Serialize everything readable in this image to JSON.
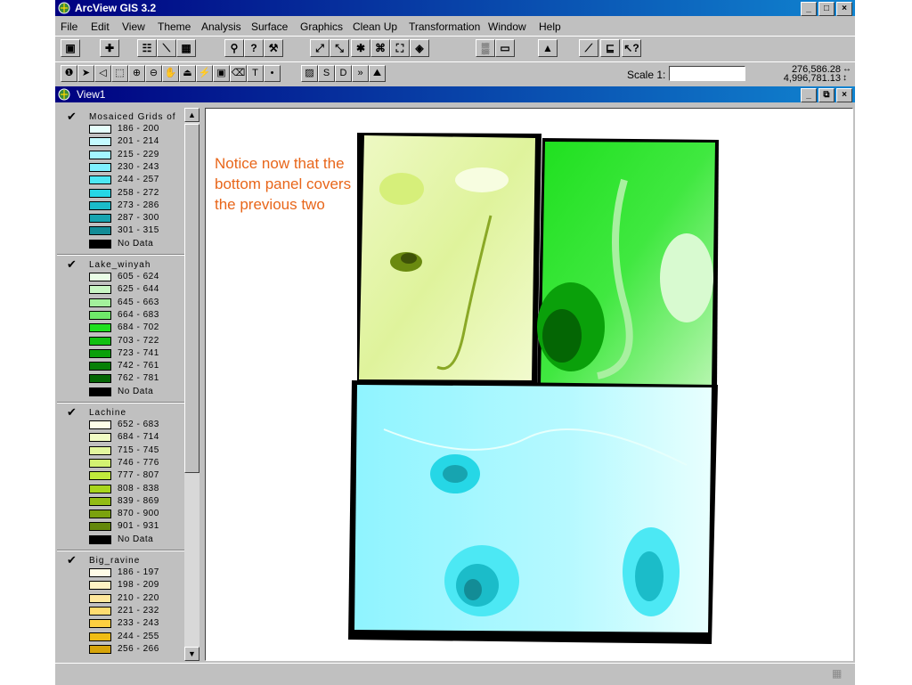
{
  "app": {
    "title": "ArcView GIS 3.2"
  },
  "window_buttons": {
    "minimize": "_",
    "maximize": "□",
    "close": "×"
  },
  "menu": [
    "File",
    "Edit",
    "View",
    "Theme",
    "Analysis",
    "Surface",
    "Graphics",
    "Clean Up",
    "Transformation",
    "Window",
    "Help"
  ],
  "toolbar": {
    "scale_label": "Scale 1:",
    "scale_value": "",
    "x_coord": "276,586.28",
    "y_coord": "4,996,781.13"
  },
  "view": {
    "title": "View1"
  },
  "note": "Notice now that the bottom panel covers the previous two",
  "themes": [
    {
      "name": "Mosaiced Grids of",
      "checked": true,
      "classes": [
        {
          "label": "186 - 200",
          "color": "#e6fffc"
        },
        {
          "label": "201 - 214",
          "color": "#c4fbff"
        },
        {
          "label": "215 - 229",
          "color": "#a3f6ff"
        },
        {
          "label": "230 - 243",
          "color": "#7ff0ff"
        },
        {
          "label": "244 - 257",
          "color": "#4ce8f4"
        },
        {
          "label": "258 - 272",
          "color": "#26d7e6"
        },
        {
          "label": "273 - 286",
          "color": "#1bbcc9"
        },
        {
          "label": "287 - 300",
          "color": "#17a4b0"
        },
        {
          "label": "301 - 315",
          "color": "#138c96"
        },
        {
          "label": "No Data",
          "color": "#000000"
        }
      ]
    },
    {
      "name": "Lake_winyah",
      "checked": true,
      "classes": [
        {
          "label": "605 - 624",
          "color": "#e9fde6"
        },
        {
          "label": "625 - 644",
          "color": "#c9f7c4"
        },
        {
          "label": "645 - 663",
          "color": "#a3f19c"
        },
        {
          "label": "664 - 683",
          "color": "#6fe86a"
        },
        {
          "label": "684 - 702",
          "color": "#1fe01f"
        },
        {
          "label": "703 - 722",
          "color": "#10c010"
        },
        {
          "label": "723 - 741",
          "color": "#0aa00a"
        },
        {
          "label": "742 - 761",
          "color": "#068006"
        },
        {
          "label": "762 - 781",
          "color": "#046604"
        },
        {
          "label": "No Data",
          "color": "#000000"
        }
      ]
    },
    {
      "name": "Lachine",
      "checked": true,
      "classes": [
        {
          "label": "652 - 683",
          "color": "#fdfde8"
        },
        {
          "label": "684 - 714",
          "color": "#f1fbc4"
        },
        {
          "label": "715 - 745",
          "color": "#e3f79e"
        },
        {
          "label": "746 - 776",
          "color": "#d3f272"
        },
        {
          "label": "777 - 807",
          "color": "#c0ea3c"
        },
        {
          "label": "808 - 838",
          "color": "#a8d61c"
        },
        {
          "label": "839 - 869",
          "color": "#92bc14"
        },
        {
          "label": "870 - 900",
          "color": "#7ba20e"
        },
        {
          "label": "901 - 931",
          "color": "#64880a"
        },
        {
          "label": "No Data",
          "color": "#000000"
        }
      ]
    },
    {
      "name": "Big_ravine",
      "checked": true,
      "classes": [
        {
          "label": "186 - 197",
          "color": "#fffbe6"
        },
        {
          "label": "198 - 209",
          "color": "#fff3c4"
        },
        {
          "label": "210 - 220",
          "color": "#ffe89c"
        },
        {
          "label": "221 - 232",
          "color": "#ffdc70"
        },
        {
          "label": "233 - 243",
          "color": "#fccf40"
        },
        {
          "label": "244 - 255",
          "color": "#f0bd14"
        },
        {
          "label": "256 - 266",
          "color": "#d6a40a"
        }
      ]
    }
  ]
}
